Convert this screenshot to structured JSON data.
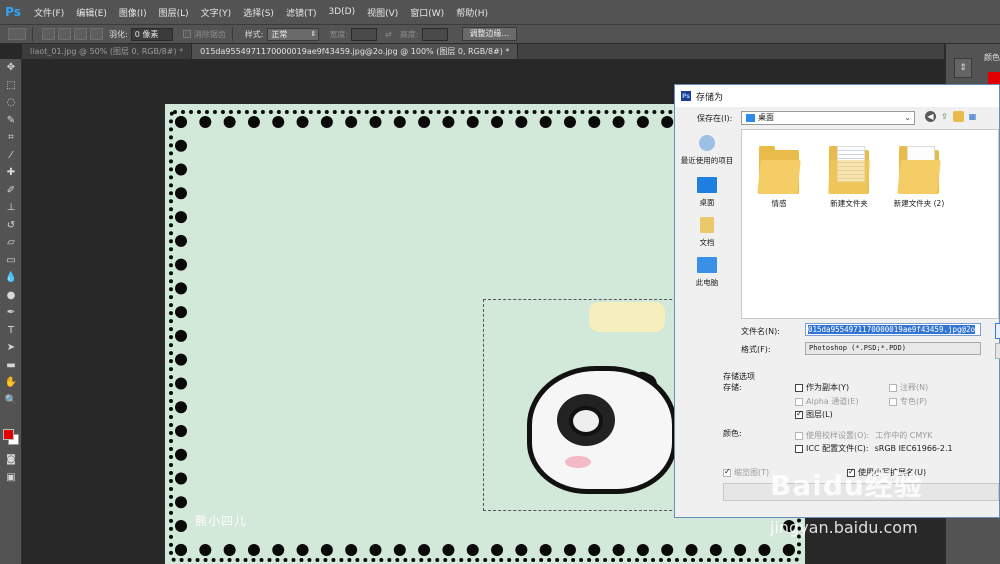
{
  "app": {
    "logo": "Ps"
  },
  "menu": [
    "文件(F)",
    "编辑(E)",
    "图像(I)",
    "图层(L)",
    "文字(Y)",
    "选择(S)",
    "滤镜(T)",
    "3D(D)",
    "视图(V)",
    "窗口(W)",
    "帮助(H)"
  ],
  "options": {
    "feather_label": "羽化:",
    "feather_value": "0 像素",
    "antialias_label": "消除锯齿",
    "style_label": "样式:",
    "style_value": "正常",
    "width_label": "宽度:",
    "height_label": "高度:",
    "refine_edge": "调整边缘..."
  },
  "tabs": [
    {
      "label": "liaot_01.jpg @ 50% (图层 0, RGB/8#) *",
      "active": false
    },
    {
      "label": "015da9554971170000019ae9f43459.jpg@2o.jpg @ 100% (图层 0, RGB/8#) *",
      "active": true
    }
  ],
  "canvas": {
    "watermark": "熊小四儿"
  },
  "right_panel": {
    "label": "颜色"
  },
  "dialog": {
    "title": "存储为",
    "title_icon": "Ps",
    "save_in_label": "保存在(I):",
    "save_in_value": "桌面",
    "places": [
      "最近使用的项目",
      "桌面",
      "文档",
      "此电脑"
    ],
    "files": [
      "情感",
      "新建文件夹",
      "新建文件夹 (2)"
    ],
    "filename_label": "文件名(N):",
    "filename_value": "015da9554971170000019ae9f43459.jpg@2o",
    "format_label": "格式(F):",
    "format_value": "Photoshop (*.PSD;*.PDD)",
    "save_options_header": "存储选项",
    "save_label": "存储:",
    "as_copy": "作为副本(Y)",
    "notes": "注释(N)",
    "alpha": "Alpha 通道(E)",
    "spot": "专色(P)",
    "layers": "图层(L)",
    "color_label": "颜色:",
    "proof": "使用校样设置(O):",
    "proof_value": "工作中的 CMYK",
    "icc": "ICC 配置文件(C):",
    "icc_value": "sRGB IEC61966-2.1",
    "thumbnail": "缩览图(T)",
    "lowercase_ext": "使用小写扩展名(U)"
  },
  "watermark": {
    "brand": "Baidu经验",
    "url": "jingyan.baidu.com"
  },
  "colors": {
    "foreground": "#e00000",
    "background": "#ffffff",
    "canvas": "#d2e8d8"
  }
}
